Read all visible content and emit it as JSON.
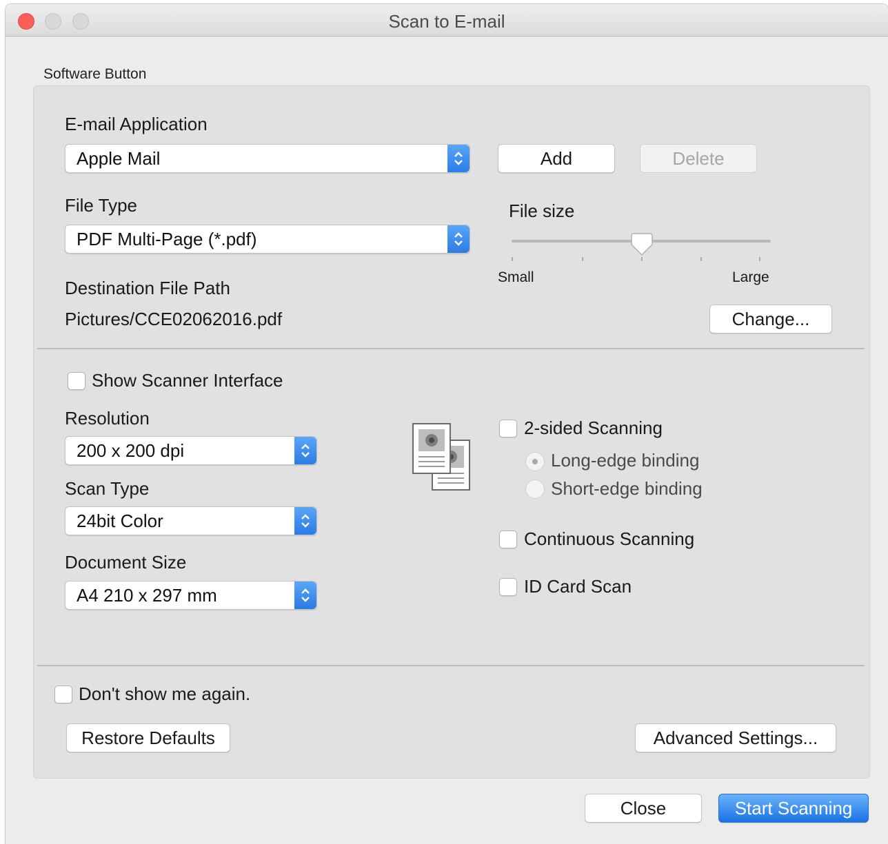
{
  "window": {
    "title": "Scan to E-mail"
  },
  "group": {
    "label": "Software Button"
  },
  "email_app": {
    "label": "E-mail Application",
    "value": "Apple Mail",
    "add_label": "Add",
    "delete_label": "Delete"
  },
  "file_type": {
    "label": "File Type",
    "value": "PDF Multi-Page (*.pdf)"
  },
  "file_size": {
    "label": "File size",
    "min_label": "Small",
    "max_label": "Large",
    "level_fraction": 0.5
  },
  "destination": {
    "label": "Destination File Path",
    "path": "Pictures/CCE02062016.pdf",
    "change_label": "Change..."
  },
  "show_scanner_interface": {
    "label": "Show Scanner Interface",
    "checked": false
  },
  "resolution": {
    "label": "Resolution",
    "value": "200 x 200 dpi"
  },
  "scan_type": {
    "label": "Scan Type",
    "value": "24bit Color"
  },
  "document_size": {
    "label": "Document Size",
    "value": "A4 210 x 297 mm"
  },
  "two_sided": {
    "label": "2-sided Scanning",
    "checked": false,
    "long_edge_label": "Long-edge binding",
    "short_edge_label": "Short-edge binding",
    "selected": "Long-edge binding"
  },
  "continuous": {
    "label": "Continuous Scanning",
    "checked": false
  },
  "id_card": {
    "label": "ID Card Scan",
    "checked": false
  },
  "dont_show": {
    "label": "Don't show me again.",
    "checked": false
  },
  "footer": {
    "restore_label": "Restore Defaults",
    "advanced_label": "Advanced Settings...",
    "close_label": "Close",
    "start_label": "Start Scanning"
  },
  "icons": {
    "duplex": "duplex-pages-icon",
    "select_arrows": "chevron-updown-icon"
  },
  "colors": {
    "accent": "#1a72e5",
    "close_dot": "#fc5f57"
  }
}
